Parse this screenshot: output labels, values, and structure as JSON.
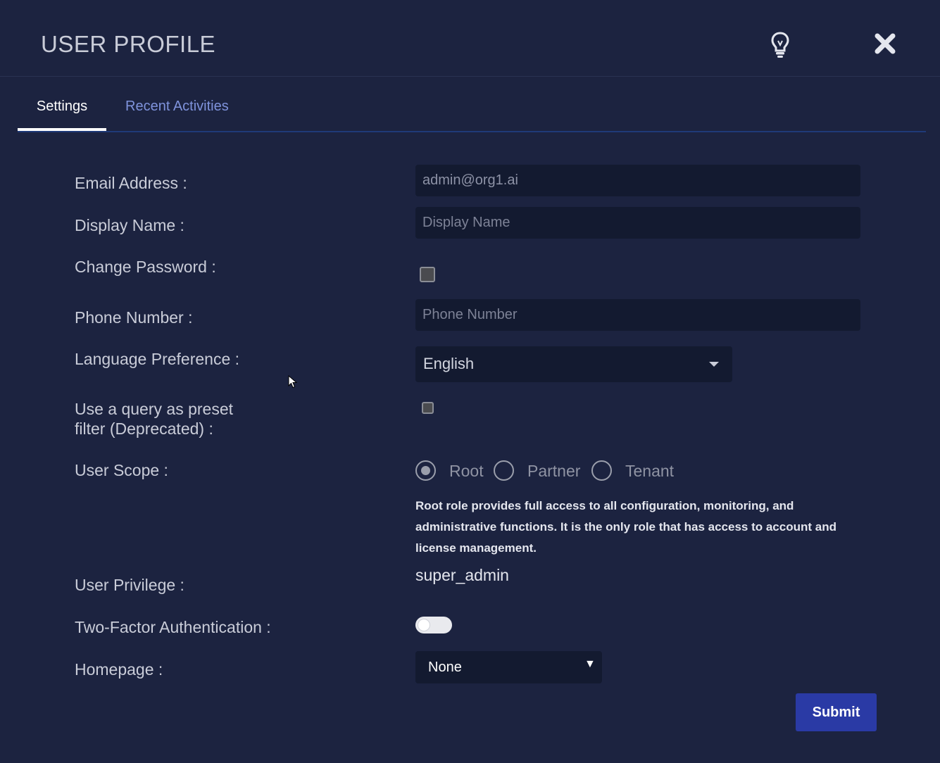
{
  "header": {
    "title": "USER PROFILE",
    "hint_icon": "lightbulb-icon",
    "close_icon": "close-icon"
  },
  "tabs": [
    {
      "label": "Settings",
      "active": true
    },
    {
      "label": "Recent Activities",
      "active": false
    }
  ],
  "form": {
    "email": {
      "label": "Email Address :",
      "value": "admin@org1.ai"
    },
    "display_name": {
      "label": "Display Name :",
      "placeholder": "Display Name"
    },
    "change_password": {
      "label": "Change Password :",
      "checked": false
    },
    "phone": {
      "label": "Phone Number :",
      "placeholder": "Phone Number"
    },
    "language": {
      "label": "Language Preference :",
      "value": "English"
    },
    "preset_filter": {
      "label_line1": "Use a query as preset",
      "label_line2": "filter (Deprecated) :",
      "checked": false
    },
    "user_scope": {
      "label": "User Scope :",
      "options": [
        "Root",
        "Partner",
        "Tenant"
      ],
      "selected": "Root",
      "description": "Root role provides full access to all configuration, monitoring, and administrative functions. It is the only role that has access to account and license management."
    },
    "user_privilege": {
      "label": "User Privilege :",
      "value": "super_admin"
    },
    "two_factor": {
      "label": "Two-Factor Authentication :",
      "enabled": false
    },
    "homepage": {
      "label": "Homepage :",
      "value": "None",
      "caret": "▼"
    }
  },
  "actions": {
    "submit_label": "Submit"
  },
  "colors": {
    "background": "#1c2340",
    "input_bg": "#131a30",
    "tab_accent": "#1f3a78",
    "submit_bg": "#2a3aa5",
    "link_color": "#7f93dc"
  }
}
